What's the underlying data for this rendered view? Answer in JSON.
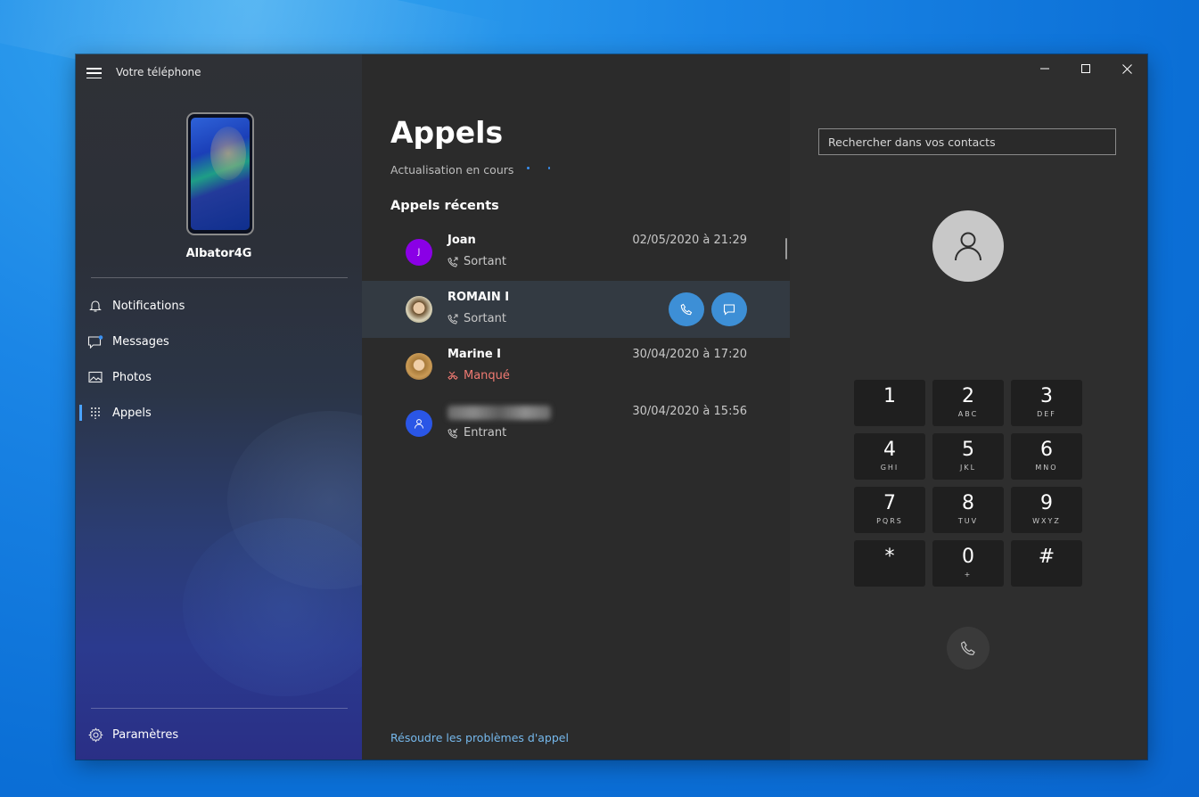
{
  "app": {
    "title": "Votre téléphone"
  },
  "device": {
    "name": "Albator4G"
  },
  "sidebar": {
    "items": [
      {
        "label": "Notifications",
        "icon": "bell-icon"
      },
      {
        "label": "Messages",
        "icon": "chat-icon"
      },
      {
        "label": "Photos",
        "icon": "photo-icon"
      },
      {
        "label": "Appels",
        "icon": "dialpad-icon",
        "active": true
      }
    ],
    "settings_label": "Paramètres"
  },
  "calls_panel": {
    "title": "Appels",
    "status": "Actualisation en cours",
    "section_title": "Appels récents",
    "items": [
      {
        "name": "Joan",
        "avatar_initial": "J",
        "type": "Sortant",
        "date": "02/05/2020 à 21:29"
      },
      {
        "name": "ROMAIN I",
        "type": "Sortant",
        "date": ""
      },
      {
        "name": "Marine I",
        "type": "Manqué",
        "date": "30/04/2020 à 17:20"
      },
      {
        "name": "",
        "type": "Entrant",
        "date": "30/04/2020 à 15:56"
      }
    ],
    "troubleshoot_link": "Résoudre les problèmes d'appel"
  },
  "dialer": {
    "search_placeholder": "Rechercher dans vos contacts",
    "keys": [
      {
        "digit": "1",
        "letters": ""
      },
      {
        "digit": "2",
        "letters": "ABC"
      },
      {
        "digit": "3",
        "letters": "DEF"
      },
      {
        "digit": "4",
        "letters": "GHI"
      },
      {
        "digit": "5",
        "letters": "JKL"
      },
      {
        "digit": "6",
        "letters": "MNO"
      },
      {
        "digit": "7",
        "letters": "PQRS"
      },
      {
        "digit": "8",
        "letters": "TUV"
      },
      {
        "digit": "9",
        "letters": "WXYZ"
      },
      {
        "digit": "*",
        "letters": ""
      },
      {
        "digit": "0",
        "letters": "+"
      },
      {
        "digit": "#",
        "letters": ""
      }
    ]
  },
  "colors": {
    "accent": "#3d8fd6",
    "missed": "#f07a72",
    "link": "#76b9ed",
    "avatar_joan": "#8a00e6",
    "avatar_unknown": "#2a56e6"
  }
}
